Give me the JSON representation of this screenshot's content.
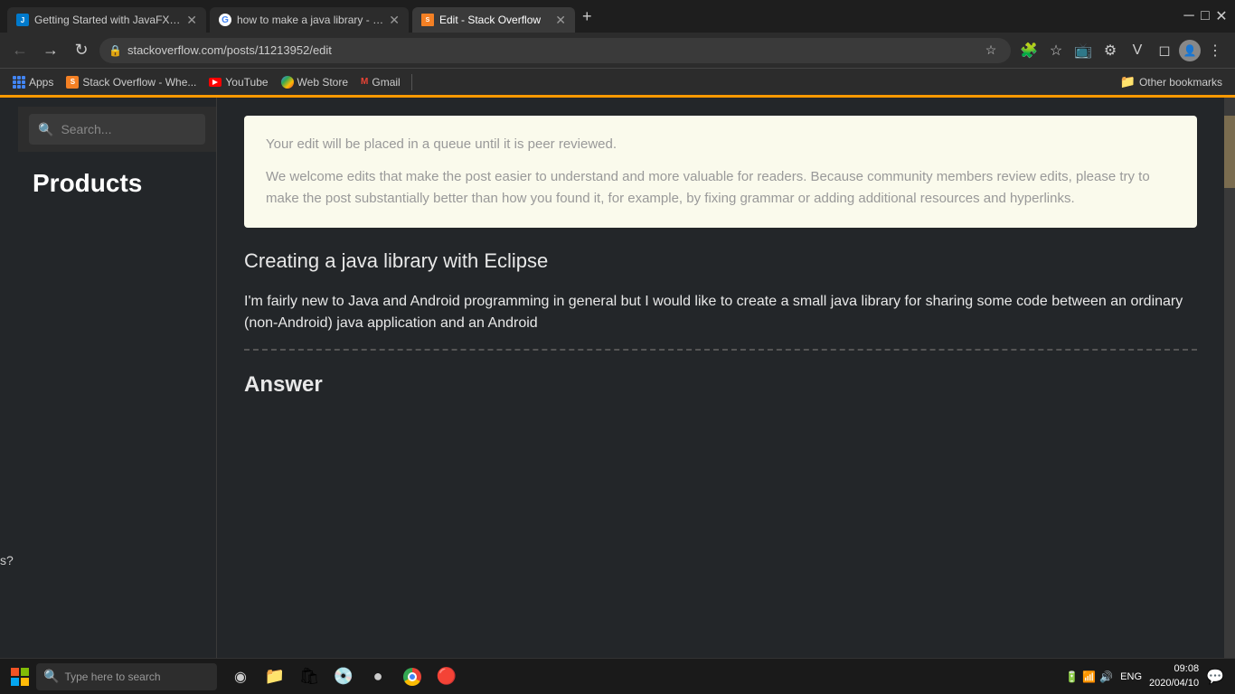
{
  "browser": {
    "tabs": [
      {
        "id": "tab1",
        "title": "Getting Started with JavaFX Game P",
        "favicon_type": "fx",
        "active": false
      },
      {
        "id": "tab2",
        "title": "how to make a java library - Google...",
        "favicon_type": "g",
        "active": false
      },
      {
        "id": "tab3",
        "title": "Edit - Stack Overflow",
        "favicon_type": "so",
        "active": true
      }
    ],
    "address": "stackoverflow.com/posts/11213952/edit",
    "new_tab_label": "+",
    "window_controls": [
      "─",
      "□",
      "✕"
    ]
  },
  "bookmarks": {
    "items": [
      {
        "id": "apps",
        "label": "Apps",
        "type": "apps"
      },
      {
        "id": "so",
        "label": "Stack Overflow - Whe...",
        "type": "so"
      },
      {
        "id": "yt",
        "label": "YouTube",
        "type": "yt"
      },
      {
        "id": "ws",
        "label": "Web Store",
        "type": "ws"
      },
      {
        "id": "gmail",
        "label": "Gmail",
        "type": "gmail"
      }
    ],
    "other_label": "Other bookmarks"
  },
  "sidebar": {
    "products_label": "Products",
    "search_placeholder": "Search..."
  },
  "notice": {
    "line1": "Your edit will be placed in a queue until it is peer reviewed.",
    "line2": "We welcome edits that make the post easier to understand and more valuable for readers. Because community members review edits, please try to make the post substantially better than how you found it, for example, by fixing grammar or adding additional resources and hyperlinks."
  },
  "question": {
    "title": "Creating a java library with Eclipse",
    "body": "I'm fairly new to Java and Android programming in general but I would like to create a small java library for sharing some code between an ordinary (non-Android) java application and an Android"
  },
  "answer_section": {
    "label": "Answer"
  },
  "left_edge": {
    "text": "s?"
  },
  "taskbar": {
    "search_placeholder": "Type here to search",
    "lang": "ENG",
    "time": "09:08",
    "date": "2020/04/10",
    "icons": [
      "⊞",
      "◯",
      "❑",
      "📁",
      "🔒",
      "💿",
      "●",
      "🌐"
    ]
  }
}
